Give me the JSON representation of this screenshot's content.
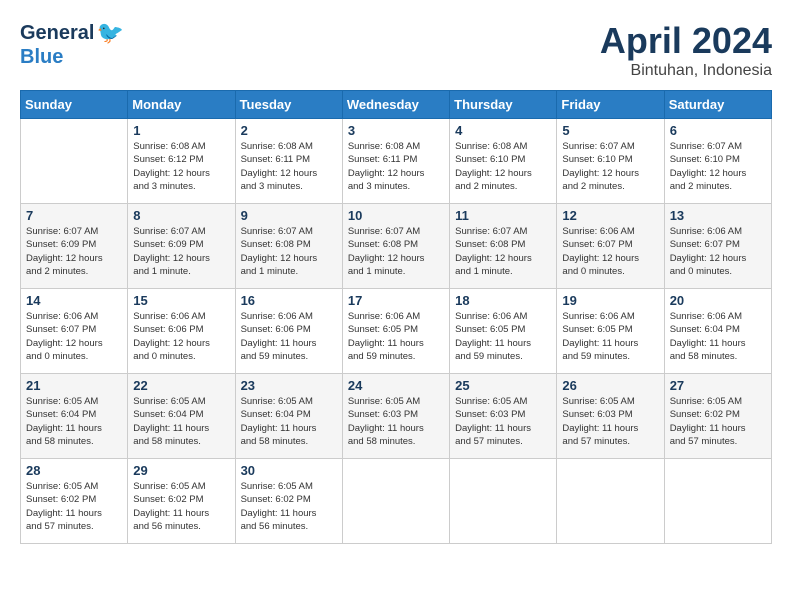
{
  "header": {
    "logo_general": "General",
    "logo_blue": "Blue",
    "title": "April 2024",
    "subtitle": "Bintuhan, Indonesia"
  },
  "columns": [
    "Sunday",
    "Monday",
    "Tuesday",
    "Wednesday",
    "Thursday",
    "Friday",
    "Saturday"
  ],
  "weeks": [
    [
      {
        "day": "",
        "info": ""
      },
      {
        "day": "1",
        "info": "Sunrise: 6:08 AM\nSunset: 6:12 PM\nDaylight: 12 hours\nand 3 minutes."
      },
      {
        "day": "2",
        "info": "Sunrise: 6:08 AM\nSunset: 6:11 PM\nDaylight: 12 hours\nand 3 minutes."
      },
      {
        "day": "3",
        "info": "Sunrise: 6:08 AM\nSunset: 6:11 PM\nDaylight: 12 hours\nand 3 minutes."
      },
      {
        "day": "4",
        "info": "Sunrise: 6:08 AM\nSunset: 6:10 PM\nDaylight: 12 hours\nand 2 minutes."
      },
      {
        "day": "5",
        "info": "Sunrise: 6:07 AM\nSunset: 6:10 PM\nDaylight: 12 hours\nand 2 minutes."
      },
      {
        "day": "6",
        "info": "Sunrise: 6:07 AM\nSunset: 6:10 PM\nDaylight: 12 hours\nand 2 minutes."
      }
    ],
    [
      {
        "day": "7",
        "info": "Sunrise: 6:07 AM\nSunset: 6:09 PM\nDaylight: 12 hours\nand 2 minutes."
      },
      {
        "day": "8",
        "info": "Sunrise: 6:07 AM\nSunset: 6:09 PM\nDaylight: 12 hours\nand 1 minute."
      },
      {
        "day": "9",
        "info": "Sunrise: 6:07 AM\nSunset: 6:08 PM\nDaylight: 12 hours\nand 1 minute."
      },
      {
        "day": "10",
        "info": "Sunrise: 6:07 AM\nSunset: 6:08 PM\nDaylight: 12 hours\nand 1 minute."
      },
      {
        "day": "11",
        "info": "Sunrise: 6:07 AM\nSunset: 6:08 PM\nDaylight: 12 hours\nand 1 minute."
      },
      {
        "day": "12",
        "info": "Sunrise: 6:06 AM\nSunset: 6:07 PM\nDaylight: 12 hours\nand 0 minutes."
      },
      {
        "day": "13",
        "info": "Sunrise: 6:06 AM\nSunset: 6:07 PM\nDaylight: 12 hours\nand 0 minutes."
      }
    ],
    [
      {
        "day": "14",
        "info": "Sunrise: 6:06 AM\nSunset: 6:07 PM\nDaylight: 12 hours\nand 0 minutes."
      },
      {
        "day": "15",
        "info": "Sunrise: 6:06 AM\nSunset: 6:06 PM\nDaylight: 12 hours\nand 0 minutes."
      },
      {
        "day": "16",
        "info": "Sunrise: 6:06 AM\nSunset: 6:06 PM\nDaylight: 11 hours\nand 59 minutes."
      },
      {
        "day": "17",
        "info": "Sunrise: 6:06 AM\nSunset: 6:05 PM\nDaylight: 11 hours\nand 59 minutes."
      },
      {
        "day": "18",
        "info": "Sunrise: 6:06 AM\nSunset: 6:05 PM\nDaylight: 11 hours\nand 59 minutes."
      },
      {
        "day": "19",
        "info": "Sunrise: 6:06 AM\nSunset: 6:05 PM\nDaylight: 11 hours\nand 59 minutes."
      },
      {
        "day": "20",
        "info": "Sunrise: 6:06 AM\nSunset: 6:04 PM\nDaylight: 11 hours\nand 58 minutes."
      }
    ],
    [
      {
        "day": "21",
        "info": "Sunrise: 6:05 AM\nSunset: 6:04 PM\nDaylight: 11 hours\nand 58 minutes."
      },
      {
        "day": "22",
        "info": "Sunrise: 6:05 AM\nSunset: 6:04 PM\nDaylight: 11 hours\nand 58 minutes."
      },
      {
        "day": "23",
        "info": "Sunrise: 6:05 AM\nSunset: 6:04 PM\nDaylight: 11 hours\nand 58 minutes."
      },
      {
        "day": "24",
        "info": "Sunrise: 6:05 AM\nSunset: 6:03 PM\nDaylight: 11 hours\nand 58 minutes."
      },
      {
        "day": "25",
        "info": "Sunrise: 6:05 AM\nSunset: 6:03 PM\nDaylight: 11 hours\nand 57 minutes."
      },
      {
        "day": "26",
        "info": "Sunrise: 6:05 AM\nSunset: 6:03 PM\nDaylight: 11 hours\nand 57 minutes."
      },
      {
        "day": "27",
        "info": "Sunrise: 6:05 AM\nSunset: 6:02 PM\nDaylight: 11 hours\nand 57 minutes."
      }
    ],
    [
      {
        "day": "28",
        "info": "Sunrise: 6:05 AM\nSunset: 6:02 PM\nDaylight: 11 hours\nand 57 minutes."
      },
      {
        "day": "29",
        "info": "Sunrise: 6:05 AM\nSunset: 6:02 PM\nDaylight: 11 hours\nand 56 minutes."
      },
      {
        "day": "30",
        "info": "Sunrise: 6:05 AM\nSunset: 6:02 PM\nDaylight: 11 hours\nand 56 minutes."
      },
      {
        "day": "",
        "info": ""
      },
      {
        "day": "",
        "info": ""
      },
      {
        "day": "",
        "info": ""
      },
      {
        "day": "",
        "info": ""
      }
    ]
  ]
}
